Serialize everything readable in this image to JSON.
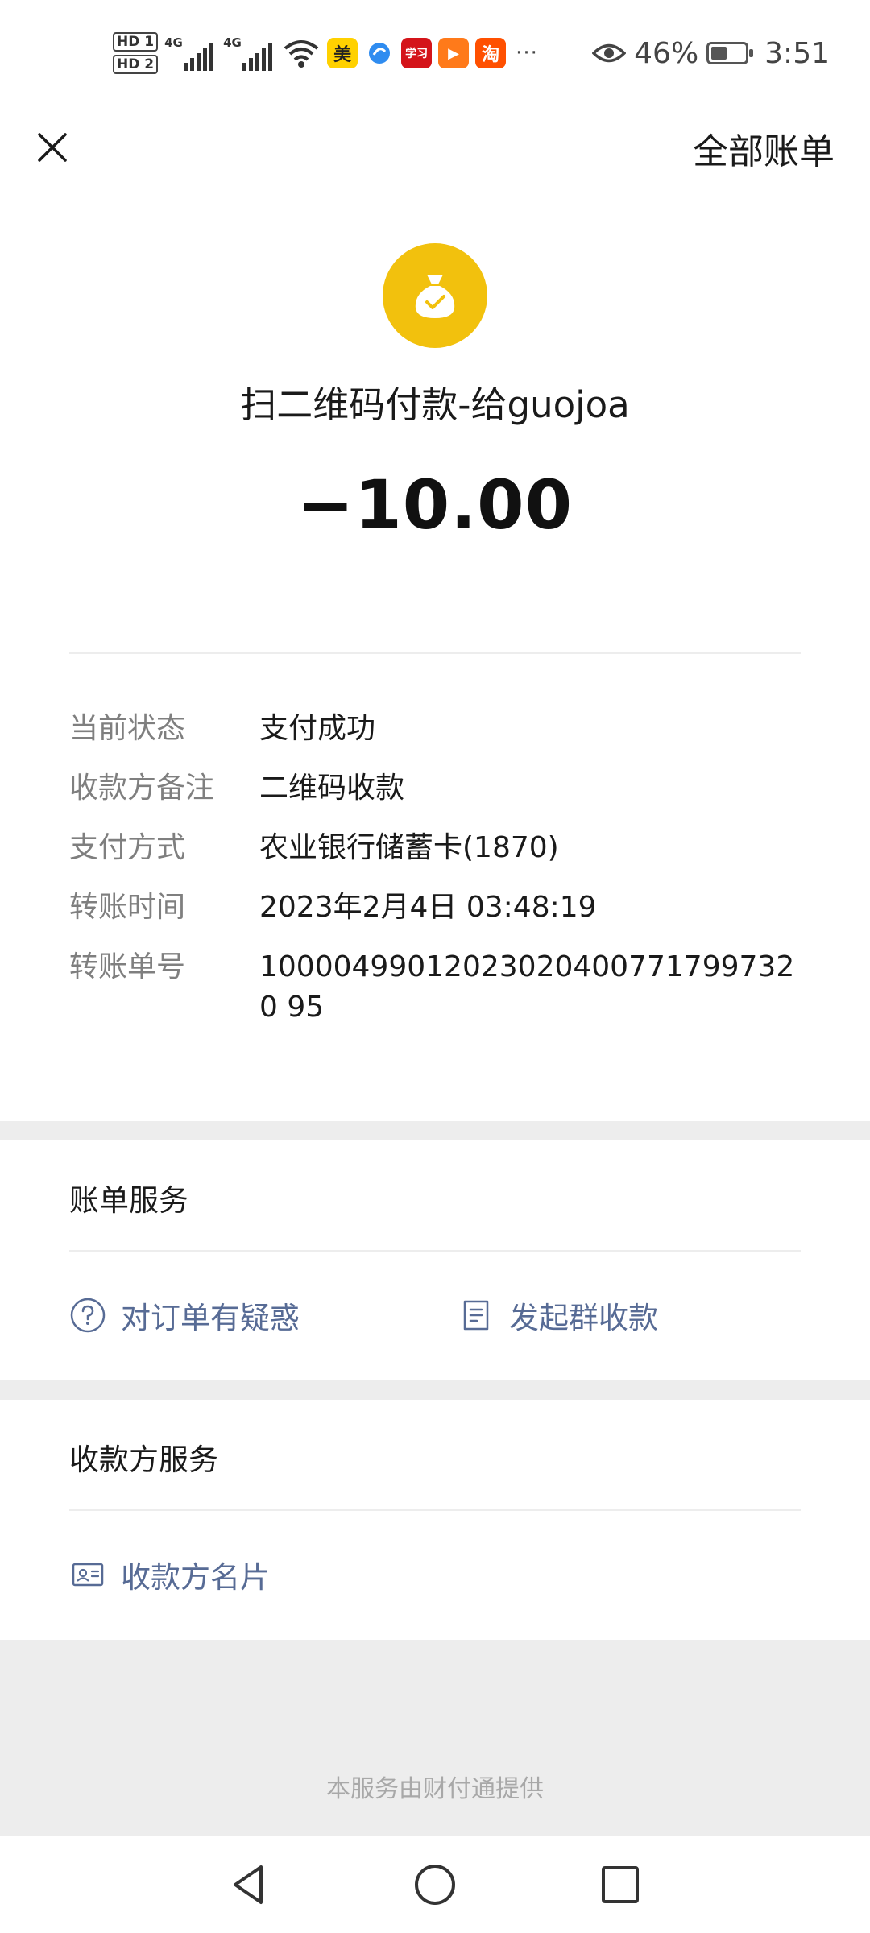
{
  "status_bar": {
    "sim1": "HD 1",
    "sim2": "HD 2",
    "net1": "4G",
    "net2": "4G",
    "apps": [
      {
        "icon": "meituan-icon",
        "text": "美",
        "color": "#ffd100"
      },
      {
        "icon": "browser-icon",
        "text": "",
        "color": "#2f8cf0"
      },
      {
        "icon": "xuexi-icon",
        "text": "学习",
        "color": "#d4141a"
      },
      {
        "icon": "video-icon",
        "text": "▶",
        "color": "#ff7a1a"
      },
      {
        "icon": "taobao-icon",
        "text": "淘",
        "color": "#ff5000"
      }
    ],
    "more": "···",
    "battery_percent": "46%",
    "battery_level": 0.46,
    "time": "3:51"
  },
  "nav": {
    "close_icon": "close-icon",
    "right_label": "全部账单"
  },
  "transaction": {
    "icon": "money-bag-icon",
    "icon_color": "#f2c10d",
    "title": "扫二维码付款-给guojoa",
    "amount": "−10.00"
  },
  "details": [
    {
      "label": "当前状态",
      "value": "支付成功"
    },
    {
      "label": "收款方备注",
      "value": "二维码收款"
    },
    {
      "label": "支付方式",
      "value": "农业银行储蓄卡(1870)"
    },
    {
      "label": "转账时间",
      "value": "2023年2月4日 03:48:19"
    },
    {
      "label": "转账单号",
      "value": "100004990120230204007717997320 95"
    }
  ],
  "bill_service": {
    "title": "账单服务",
    "actions": [
      {
        "icon": "question-circle-icon",
        "label": "对订单有疑惑"
      },
      {
        "icon": "receipt-icon",
        "label": "发起群收款"
      }
    ]
  },
  "payee_service": {
    "title": "收款方服务",
    "actions": [
      {
        "icon": "contact-card-icon",
        "label": "收款方名片"
      }
    ]
  },
  "footer": {
    "text": "本服务由财付通提供"
  },
  "colors": {
    "link": "#576b95",
    "gap": "#ededed",
    "label_gray": "#7f7f7f"
  }
}
